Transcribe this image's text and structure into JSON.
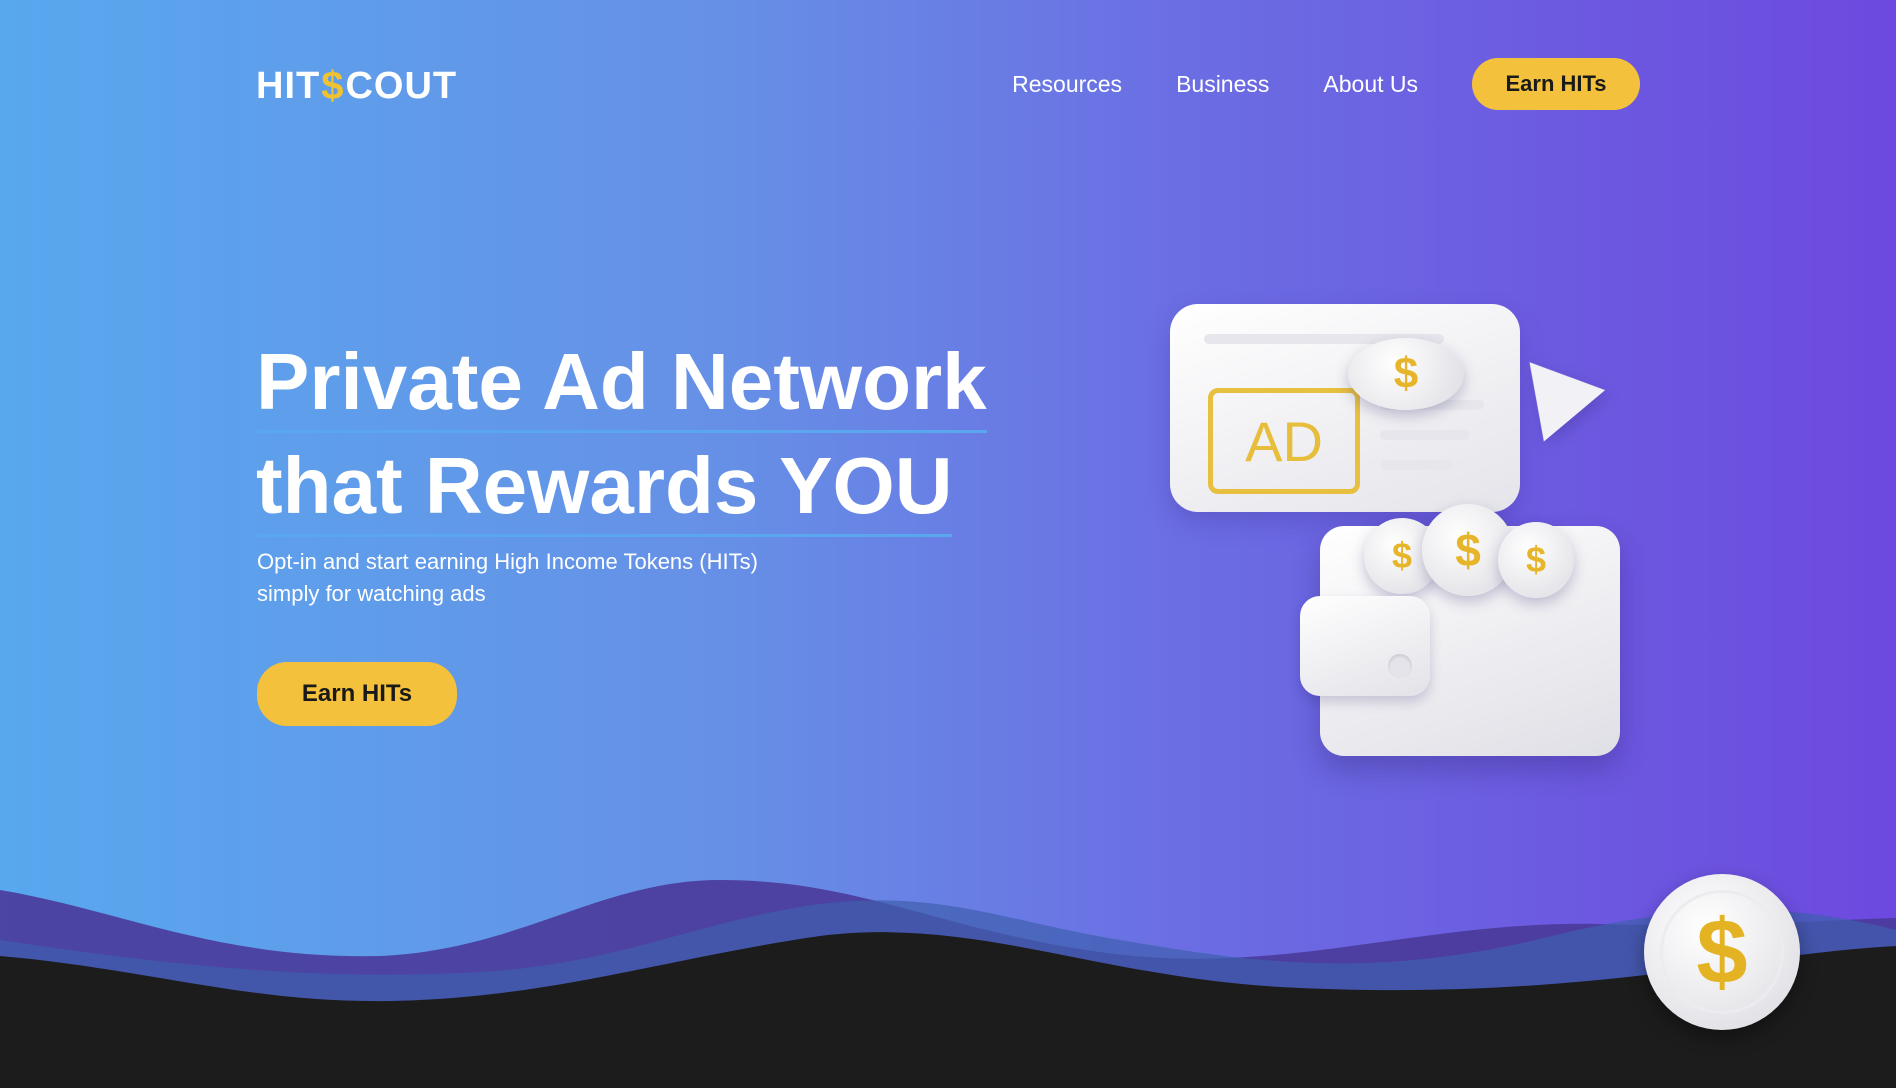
{
  "header": {
    "logo": {
      "part1": "HIT",
      "dollar": "$",
      "part2": "COUT"
    },
    "nav": [
      "Resources",
      "Business",
      "About Us"
    ],
    "cta_label": "Earn HITs"
  },
  "hero": {
    "title_line1": "Private Ad Network",
    "title_line2": "that Rewards YOU",
    "subtitle_line1": "Opt-in and start earning High Income Tokens (HITs)",
    "subtitle_line2": "simply for watching ads",
    "cta_label": "Earn HITs"
  },
  "illustration": {
    "ad_label": "AD",
    "coin_symbol": "$"
  },
  "floating_coin": {
    "symbol": "$"
  },
  "colors": {
    "accent_yellow": "#f4c13c",
    "gradient_start": "#58a8ee",
    "gradient_end": "#6d49df",
    "footer_dark": "#1c1c1c"
  }
}
